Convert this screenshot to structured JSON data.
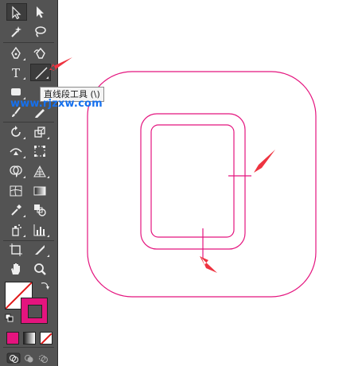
{
  "tooltip": {
    "text": "直线段工具 (\\)"
  },
  "watermark": {
    "text": "www.rjzxw.com"
  },
  "colors": {
    "stroke": "#e4147e",
    "arrow": "#ee3340",
    "watermark": "#1570ee",
    "toolbar": "#535353"
  },
  "tools": [
    "selection",
    "direct-selection",
    "magic-wand",
    "lasso",
    "pen",
    "curvature",
    "type",
    "line-segment",
    "rectangle",
    "paintbrush",
    "pencil",
    "eraser",
    "rotate",
    "scale",
    "width",
    "free-transform",
    "shape-builder",
    "perspective-grid",
    "mesh",
    "gradient",
    "eyedropper",
    "blend",
    "symbol-sprayer",
    "column-graph",
    "artboard",
    "slice",
    "hand",
    "zoom"
  ],
  "type_tool_glyph": "T"
}
